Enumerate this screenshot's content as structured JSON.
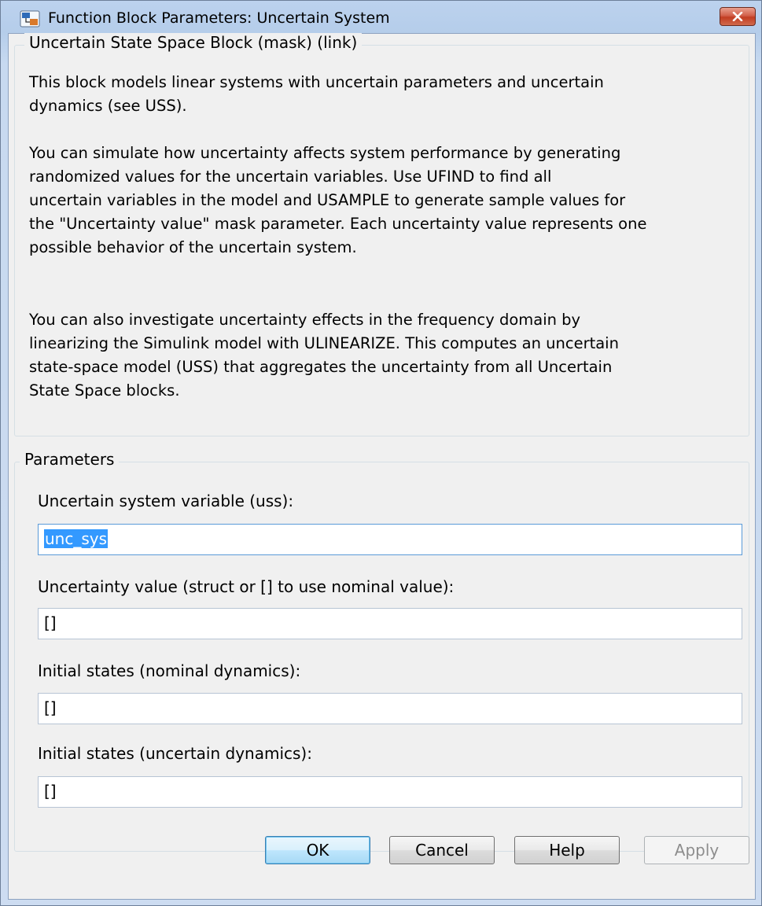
{
  "window": {
    "title": "Function Block Parameters: Uncertain System"
  },
  "description_group": {
    "title": "Uncertain State Space Block (mask) (link)",
    "paragraphs": [
      "This block models linear systems with uncertain parameters and uncertain\ndynamics (see USS).",
      "You can simulate how uncertainty affects system performance by generating\nrandomized values for the uncertain variables. Use UFIND to find all\nuncertain variables in the model and USAMPLE to generate sample values for\nthe \"Uncertainty value\" mask parameter. Each uncertainty value represents one\npossible behavior of the uncertain system.",
      "You can also investigate uncertainty effects in the frequency domain by\nlinearizing the Simulink model with ULINEARIZE. This computes an uncertain\nstate-space model (USS) that aggregates the uncertainty from all Uncertain\nState Space blocks."
    ]
  },
  "parameters_group": {
    "title": "Parameters",
    "fields": [
      {
        "label": "Uncertain system variable (uss):",
        "value": "unc_sys"
      },
      {
        "label": "Uncertainty value (struct or [] to use nominal value):",
        "value": "[]"
      },
      {
        "label": "Initial states (nominal dynamics):",
        "value": "[]"
      },
      {
        "label": "Initial states (uncertain dynamics):",
        "value": "[]"
      }
    ]
  },
  "buttons": {
    "ok": "OK",
    "cancel": "Cancel",
    "help": "Help",
    "apply": "Apply"
  },
  "colors": {
    "selection": "#3399ff",
    "close_button": "#c23d22",
    "dialog_background": "#f0f0f0"
  },
  "icons": {
    "app": "simulink-block-icon",
    "close": "close-icon"
  }
}
